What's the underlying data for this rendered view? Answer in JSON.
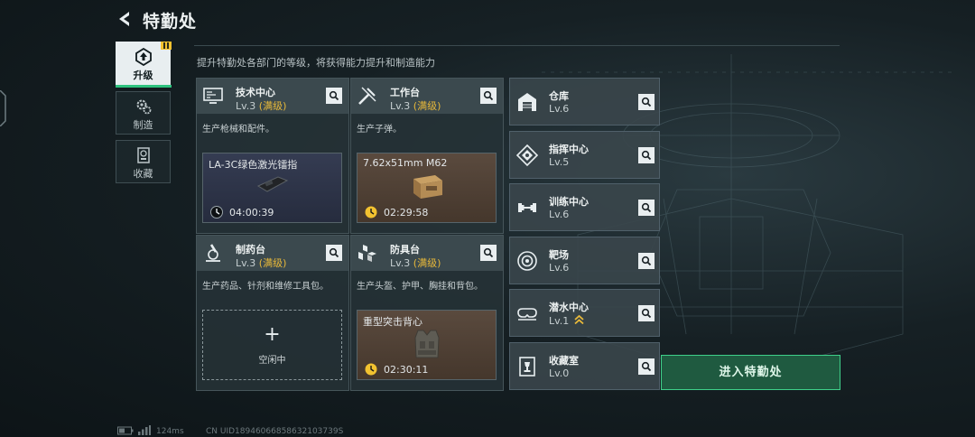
{
  "header": {
    "title": "特勤处",
    "subtitle": "提升特勤处各部门的等级，将获得能力提升和制造能力"
  },
  "side_tabs": [
    {
      "label": "升级",
      "icon": "upgrade-icon",
      "active": true
    },
    {
      "label": "制造",
      "icon": "gears-icon",
      "active": false
    },
    {
      "label": "收藏",
      "icon": "collection-icon",
      "active": false
    }
  ],
  "workshops": [
    {
      "name": "技术中心",
      "level": "Lv.3",
      "max_label": "(满级)",
      "icon": "computer-icon",
      "desc": "生产枪械和配件。",
      "item": "LA-3C绿色激光镭指",
      "timer": "04:00:39",
      "slot_color": "#2b3246"
    },
    {
      "name": "工作台",
      "level": "Lv.3",
      "max_label": "(满级)",
      "icon": "tools-icon",
      "desc": "生产子弹。",
      "item": "7.62x51mm M62",
      "timer": "02:29:58",
      "slot_color": "#4f4034"
    },
    {
      "name": "制药台",
      "level": "Lv.3",
      "max_label": "(满级)",
      "icon": "microscope-icon",
      "desc": "生产药品、针剂和维修工具包。",
      "idle_label": "空闲中"
    },
    {
      "name": "防具台",
      "level": "Lv.3",
      "max_label": "(满级)",
      "icon": "armor-crate-icon",
      "desc": "生产头盔、护甲、胸挂和背包。",
      "item": "重型突击背心",
      "timer": "02:30:11",
      "slot_color": "#4f4034"
    }
  ],
  "facilities": [
    {
      "name": "仓库",
      "level": "Lv.6",
      "icon": "warehouse-icon"
    },
    {
      "name": "指挥中心",
      "level": "Lv.5",
      "icon": "command-icon"
    },
    {
      "name": "训练中心",
      "level": "Lv.6",
      "icon": "dumbbell-icon"
    },
    {
      "name": "靶场",
      "level": "Lv.6",
      "icon": "target-icon"
    },
    {
      "name": "潜水中心",
      "level": "Lv.1",
      "icon": "diving-mask-icon",
      "upgrade_available": true
    },
    {
      "name": "收藏室",
      "level": "Lv.0",
      "icon": "trophy-room-icon"
    }
  ],
  "enter_button": "进入特勤处",
  "footer": {
    "ping": "124ms",
    "uid": "CN UID18946066858632103739S"
  },
  "colors": {
    "accent_green": "#2ec27e",
    "max_level": "#e8b93a",
    "badge_yellow": "#f2c230",
    "enter_bg": "#1f5a40"
  }
}
